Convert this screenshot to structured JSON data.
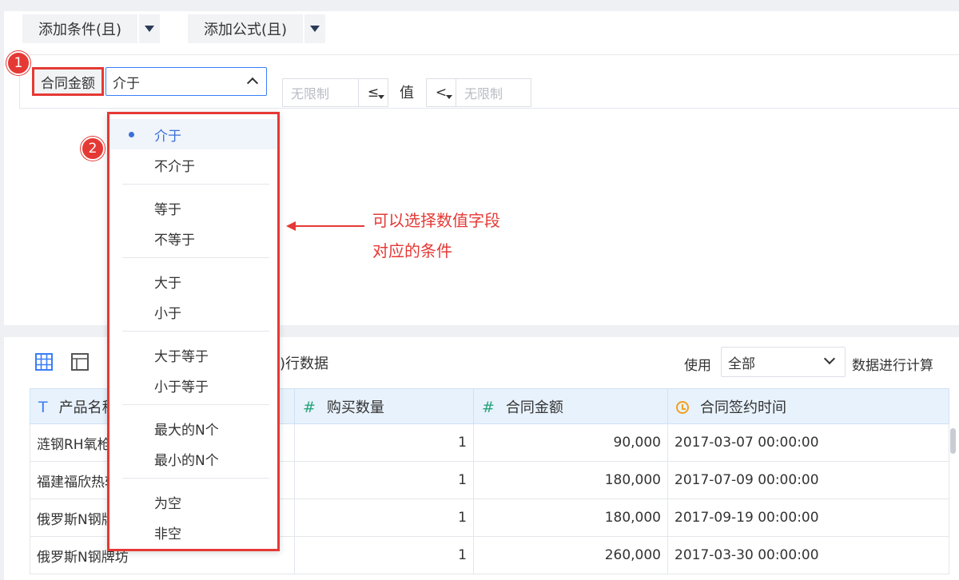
{
  "condition_bar": {
    "add_condition_label": "添加条件(且)",
    "add_formula_label": "添加公式(且)"
  },
  "filter": {
    "field_label": "合同金额",
    "operator_value": "介于",
    "min_placeholder": "无限制",
    "min_operator": "≤",
    "value_label": "值",
    "max_operator": "<",
    "max_placeholder": "无限制"
  },
  "badges": {
    "one": "1",
    "two": "2"
  },
  "dropdown": {
    "groups": [
      [
        {
          "label": "介于",
          "selected": true
        },
        {
          "label": "不介于"
        }
      ],
      [
        {
          "label": "等于"
        },
        {
          "label": "不等于"
        }
      ],
      [
        {
          "label": "大于"
        },
        {
          "label": "小于"
        }
      ],
      [
        {
          "label": "大于等于"
        },
        {
          "label": "小于等于"
        }
      ],
      [
        {
          "label": "最大的N个"
        },
        {
          "label": "最小的N个"
        }
      ],
      [
        {
          "label": "为空"
        },
        {
          "label": "非空"
        }
      ]
    ]
  },
  "annotation": {
    "line1": "可以选择数值字段",
    "line2": "对应的条件"
  },
  "data_toolbar": {
    "rows_text": ")行数据",
    "use_label": "使用",
    "use_value": "全部",
    "calc_label": "数据进行计算"
  },
  "table": {
    "columns": [
      {
        "icon": "T",
        "label": "产品名称"
      },
      {
        "icon": "#",
        "label": "购买数量"
      },
      {
        "icon": "#",
        "label": "合同金额"
      },
      {
        "icon": "clock",
        "label": "合同签约时间"
      }
    ],
    "rows": [
      [
        "涟钢RH氧枪",
        "1",
        "90,000",
        "2017-03-07 00:00:00"
      ],
      [
        "福建福欣热轧",
        "1",
        "180,000",
        "2017-07-09 00:00:00"
      ],
      [
        "俄罗斯N钢牌坊",
        "1",
        "180,000",
        "2017-09-19 00:00:00"
      ],
      [
        "俄罗斯N钢牌坊",
        "1",
        "260,000",
        "2017-03-30 00:00:00"
      ]
    ]
  },
  "colors": {
    "accent": "#3a7ef6",
    "highlight_red": "#e53935",
    "header_bg": "#e8f2fc"
  }
}
